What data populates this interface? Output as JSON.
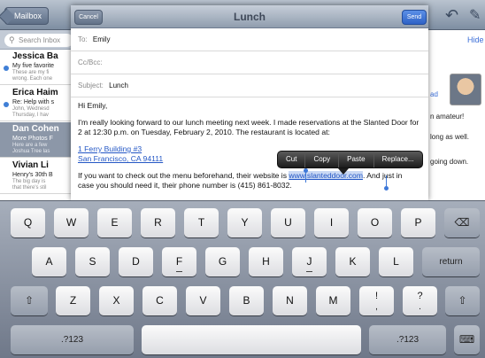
{
  "background": {
    "mailboxes_label": "Mailbox",
    "search_placeholder": "Search Inbox",
    "hide_label": "Hide",
    "messages": [
      {
        "from": "Jessica Ba",
        "subject": "My five favorite",
        "preview1": "These are my fi",
        "preview2": "wrong. Each one",
        "unread": true,
        "selected": false
      },
      {
        "from": "Erica Haim",
        "subject": "Re: Help with s",
        "preview1": "John, Wednesd",
        "preview2": "Thursday, I hav",
        "unread": true,
        "selected": false
      },
      {
        "from": "Dan Cohen",
        "subject": "More Photos F",
        "preview1": "Here are a few",
        "preview2": "Joshua Tree las",
        "unread": false,
        "selected": true
      },
      {
        "from": "Vivian Li",
        "subject": "Henry's 30th B",
        "preview1": "The big day is",
        "preview2": "that there's stil",
        "unread": false,
        "selected": false
      }
    ],
    "detail_fragments": {
      "ad": "ad",
      "line1": "n amateur!",
      "line2": "long as well.",
      "line3": "going down."
    }
  },
  "compose": {
    "title": "Lunch",
    "cancel_label": "Cancel",
    "send_label": "Send",
    "to_label": "To:",
    "to_value": "Emily",
    "cc_label": "Cc/Bcc:",
    "subject_label": "Subject:",
    "subject_value": "Lunch",
    "greeting": "Hi Emily,",
    "paragraph1": "I'm really looking forward to our lunch meeting next week. I made reservations at the Slanted Door for 2 at 12:30 p.m. on Tuesday, February 2, 2010. The restaurant is located at:",
    "address_line1": "1 Ferry Building #3",
    "address_line2": "San Francisco, CA 94111",
    "paragraph2_before": "If you want to check out the menu beforehand, their website is ",
    "paragraph2_link": "www.slanteddoor.com",
    "paragraph2_after": ". And just in case you should need it, their phone number is (415) 861-8032."
  },
  "edit_menu": {
    "items": [
      "Cut",
      "Copy",
      "Paste",
      "Replace..."
    ]
  },
  "keyboard": {
    "row1": [
      "Q",
      "W",
      "E",
      "R",
      "T",
      "Y",
      "U",
      "I",
      "O",
      "P"
    ],
    "row2": [
      "A",
      "S",
      "D",
      "F",
      "G",
      "H",
      "J",
      "K",
      "L"
    ],
    "row3": [
      "Z",
      "X",
      "C",
      "V",
      "B",
      "N",
      "M"
    ],
    "exclaim_top": "!",
    "exclaim_bottom": ",",
    "question_top": "?",
    "question_bottom": ".",
    "return_label": "return",
    "numbers_label": ".?123",
    "backspace_icon": "⌫",
    "shift_icon": "⇧",
    "hide_keyboard_icon": "⌨"
  }
}
